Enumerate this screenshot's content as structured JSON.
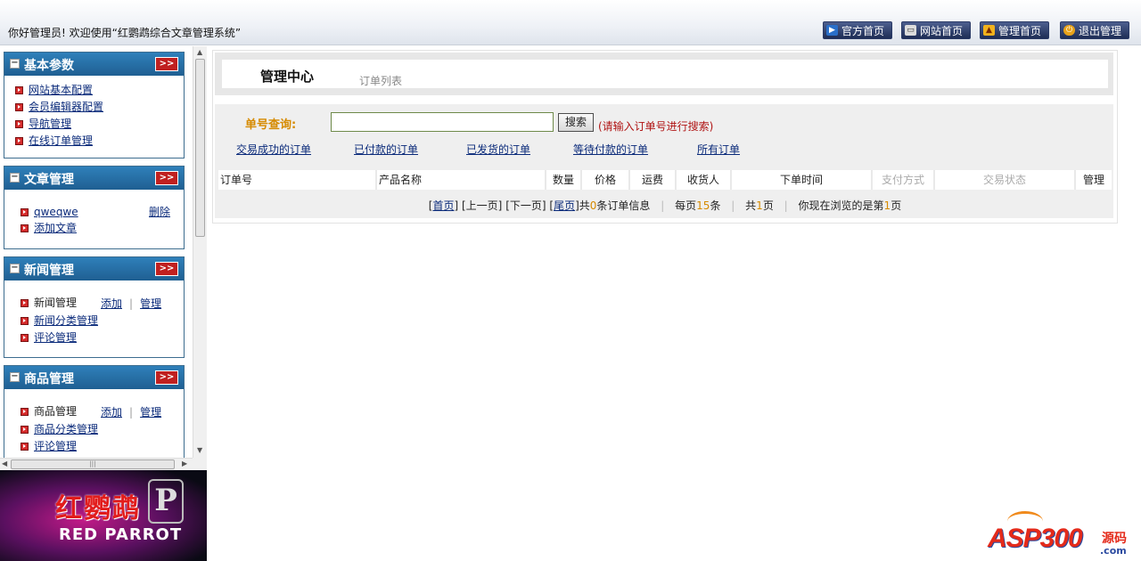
{
  "header": {
    "welcome": "你好管理员! 欢迎使用“红鹦鹉综合文章管理系统”",
    "buttons": [
      {
        "label": "官方首页",
        "icon": "play-icon"
      },
      {
        "label": "网站首页",
        "icon": "monitor-icon"
      },
      {
        "label": "管理首页",
        "icon": "warning-icon"
      },
      {
        "label": "退出管理",
        "icon": "power-icon"
      }
    ]
  },
  "sidebar": {
    "panels": [
      {
        "title": "基本参数",
        "items": [
          {
            "label": "网站基本配置"
          },
          {
            "label": "会员编辑器配置"
          },
          {
            "label": "导航管理"
          },
          {
            "label": "在线订单管理"
          }
        ]
      },
      {
        "title": "文章管理",
        "items": [
          {
            "label": "qweqwe",
            "action": "删除"
          },
          {
            "label": "添加文章"
          }
        ]
      },
      {
        "title": "新闻管理",
        "items": [
          {
            "label": "新闻管理",
            "add": "添加",
            "manage": "管理"
          },
          {
            "label": "新闻分类管理"
          },
          {
            "label": "评论管理"
          }
        ]
      },
      {
        "title": "商品管理",
        "items": [
          {
            "label": "商品管理",
            "add": "添加",
            "manage": "管理"
          },
          {
            "label": "商品分类管理"
          },
          {
            "label": "评论管理"
          }
        ]
      }
    ],
    "toggle_label": ">>"
  },
  "logo": {
    "cn": "红鹦鹉",
    "en": "RED PARROT",
    "mark": "P"
  },
  "main": {
    "title": "管理中心",
    "subtitle": "订单列表",
    "search": {
      "label": "单号查询:",
      "value": "",
      "button": "搜索",
      "hint": "(请输入订单号进行搜索)"
    },
    "filters": [
      "交易成功的订单",
      "已付款的订单",
      "已发货的订单",
      "等待付款的订单",
      "所有订单"
    ],
    "columns": [
      "订单号",
      "产品名称",
      "数量",
      "价格",
      "运费",
      "收货人",
      "下单时间",
      "支付方式",
      "交易状态",
      "管理"
    ],
    "pager": {
      "first": "首页",
      "prev": "[上一页]",
      "next": "[下一页]",
      "last": "尾页",
      "total_prefix": "共",
      "total": "0",
      "total_suffix": "条订单信息",
      "per_page_prefix": "每页",
      "per_page": "15",
      "per_page_suffix": "条",
      "pages_prefix": "共",
      "pages": "1",
      "pages_suffix": "页",
      "current_prefix": "你现在浏览的是第",
      "current": "1",
      "current_suffix": "页"
    }
  },
  "watermark": {
    "text": "ASP300",
    "cn": "源码",
    "com": ".com"
  }
}
